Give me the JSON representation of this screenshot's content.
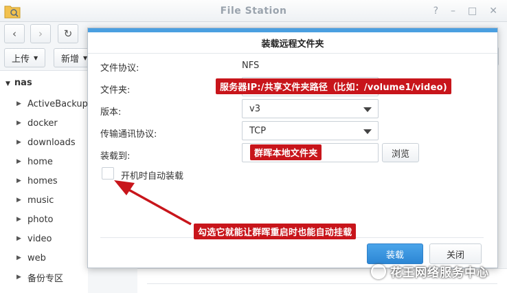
{
  "window": {
    "title": "File Station",
    "controls": [
      "?",
      "–",
      "□",
      "✕"
    ]
  },
  "toolbar": {
    "back_icon": "chevron-left-icon",
    "forward_icon": "chevron-right-icon",
    "refresh_icon": "refresh-icon",
    "upload_label": "上传",
    "new_label": "新增"
  },
  "sidebar": {
    "root": "nas",
    "items": [
      {
        "label": "ActiveBackupf"
      },
      {
        "label": "docker"
      },
      {
        "label": "downloads"
      },
      {
        "label": "home"
      },
      {
        "label": "homes"
      },
      {
        "label": "music"
      },
      {
        "label": "photo"
      },
      {
        "label": "video"
      },
      {
        "label": "web"
      },
      {
        "label": "备份专区"
      }
    ]
  },
  "dialog": {
    "title": "装载远程文件夹",
    "protocol_label": "文件协议:",
    "protocol_value": "NFS",
    "folder_label": "文件夹:",
    "folder_value": "",
    "version_label": "版本:",
    "version_value": "v3",
    "transport_label": "传输通讯协议:",
    "transport_value": "TCP",
    "mount_to_label": "装载到:",
    "mount_to_value": "",
    "browse_label": "浏览",
    "auto_mount_label": "开机时自动装载",
    "auto_mount_checked": false,
    "mount_button": "装载",
    "close_button": "关闭"
  },
  "annotations": {
    "folder_hint": "服务器IP:/共享文件夹路径（比如：/volume1/video)",
    "mount_hint": "群晖本地文件夹",
    "auto_mount_hint": "勾选它就能让群晖重启时也能自动挂载",
    "color": "#c8151b"
  },
  "watermark": {
    "text": "花王网络服务中心"
  },
  "colors": {
    "primary_button": "#2c86d4",
    "dialog_accent": "#4a9fe0"
  }
}
